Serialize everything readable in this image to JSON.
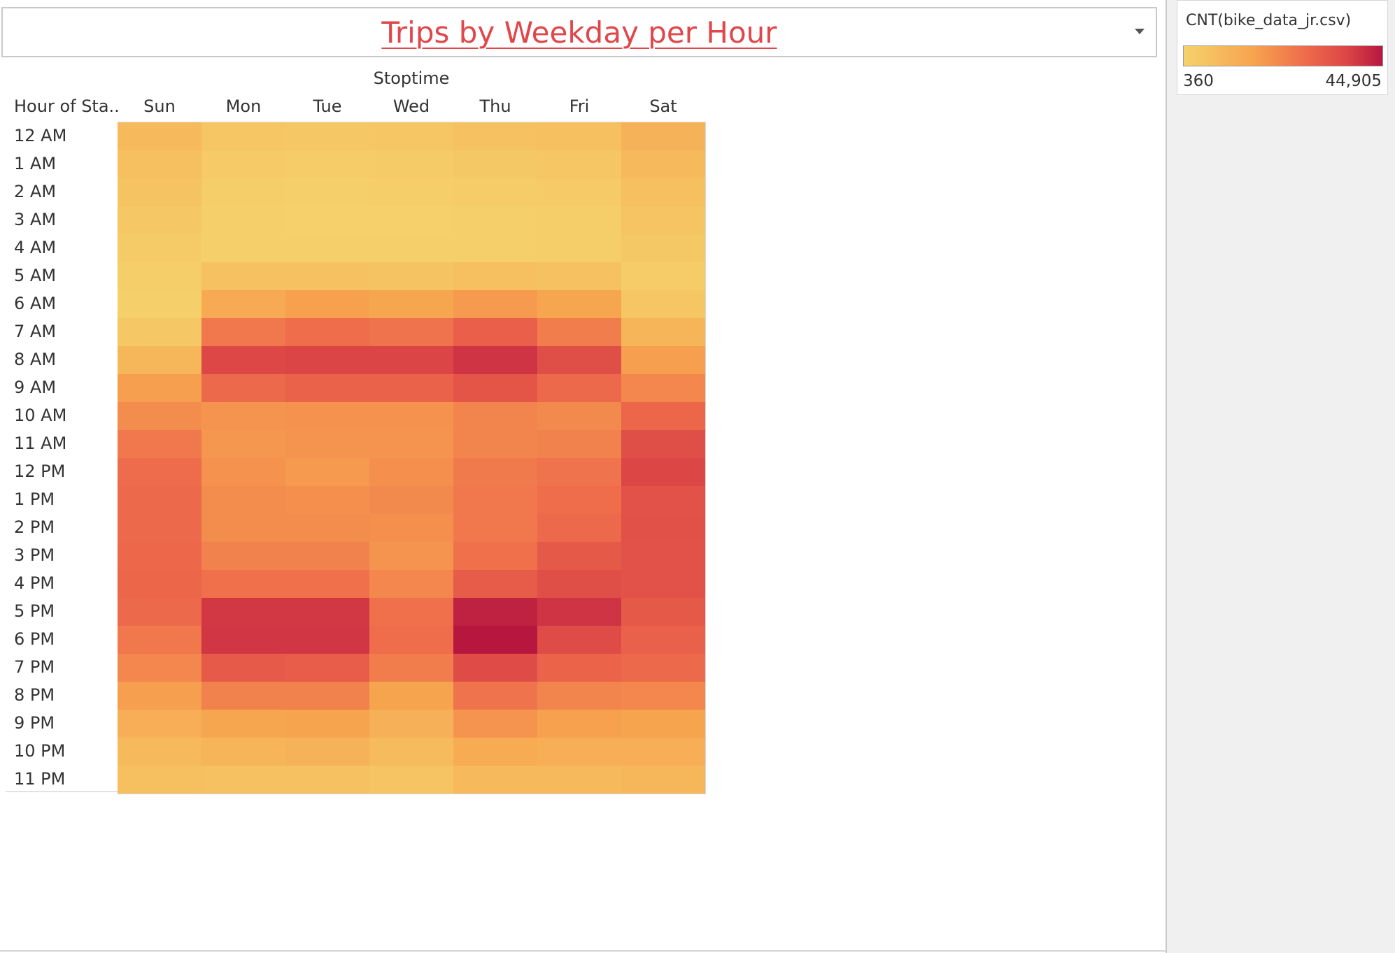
{
  "title": "Trips by Weekday per Hour",
  "legend": {
    "title": "CNT(bike_data_jr.csv)",
    "min_label": "360",
    "max_label": "44,905",
    "min_value": 360,
    "max_value": 44905,
    "colors": [
      "#f5d26c",
      "#f7a44f",
      "#ee6a4b",
      "#dc4646",
      "#b7173f"
    ]
  },
  "chart_data": {
    "type": "heatmap",
    "title": "Trips by Weekday per Hour",
    "column_header": "Stoptime",
    "row_header": "Hour of Sta..",
    "x": [
      "Sun",
      "Mon",
      "Tue",
      "Wed",
      "Thu",
      "Fri",
      "Sat"
    ],
    "y": [
      "12 AM",
      "1 AM",
      "2 AM",
      "3 AM",
      "4 AM",
      "5 AM",
      "6 AM",
      "7 AM",
      "8 AM",
      "9 AM",
      "10 AM",
      "11 AM",
      "12 PM",
      "1 PM",
      "2 PM",
      "3 PM",
      "4 PM",
      "5 PM",
      "6 PM",
      "7 PM",
      "8 PM",
      "9 PM",
      "10 PM",
      "11 PM"
    ],
    "values": [
      [
        6500,
        3500,
        3000,
        3200,
        4500,
        5000,
        8000
      ],
      [
        5000,
        2200,
        1800,
        2000,
        2800,
        3200,
        6500
      ],
      [
        4000,
        1500,
        1200,
        1300,
        1800,
        2200,
        5000
      ],
      [
        3000,
        1000,
        800,
        900,
        1200,
        1500,
        3800
      ],
      [
        2000,
        1200,
        1000,
        1000,
        1200,
        1500,
        2800
      ],
      [
        1500,
        4500,
        4500,
        4000,
        5000,
        4500,
        1800
      ],
      [
        1200,
        10000,
        12000,
        11000,
        13500,
        11000,
        3500
      ],
      [
        3000,
        20000,
        22000,
        21000,
        26000,
        19000,
        7500
      ],
      [
        7000,
        33000,
        34000,
        34000,
        38000,
        31000,
        12500
      ],
      [
        12500,
        23000,
        25000,
        25000,
        29000,
        23000,
        17000
      ],
      [
        16000,
        14500,
        15000,
        15000,
        17500,
        16500,
        24000
      ],
      [
        20000,
        14000,
        14500,
        14500,
        17500,
        18000,
        31000
      ],
      [
        22500,
        15000,
        13500,
        15500,
        19500,
        21000,
        33500
      ],
      [
        23000,
        16000,
        15500,
        16500,
        20000,
        22000,
        30000
      ],
      [
        23000,
        16000,
        16000,
        15500,
        20000,
        23000,
        30500
      ],
      [
        23500,
        18000,
        18000,
        14500,
        21500,
        28000,
        30000
      ],
      [
        24000,
        21500,
        21500,
        17000,
        27000,
        31000,
        30000
      ],
      [
        23000,
        37000,
        37000,
        21500,
        42500,
        38000,
        28000
      ],
      [
        20000,
        37500,
        37500,
        22000,
        44905,
        32000,
        25500
      ],
      [
        17000,
        27500,
        26500,
        19000,
        32000,
        24500,
        23000
      ],
      [
        12500,
        18000,
        18000,
        11500,
        21000,
        17500,
        17000
      ],
      [
        9000,
        11000,
        11500,
        8500,
        14500,
        12000,
        11500
      ],
      [
        6500,
        7500,
        8000,
        6000,
        9500,
        9000,
        9000
      ],
      [
        5000,
        4500,
        4500,
        3800,
        6500,
        6500,
        7000
      ]
    ]
  }
}
